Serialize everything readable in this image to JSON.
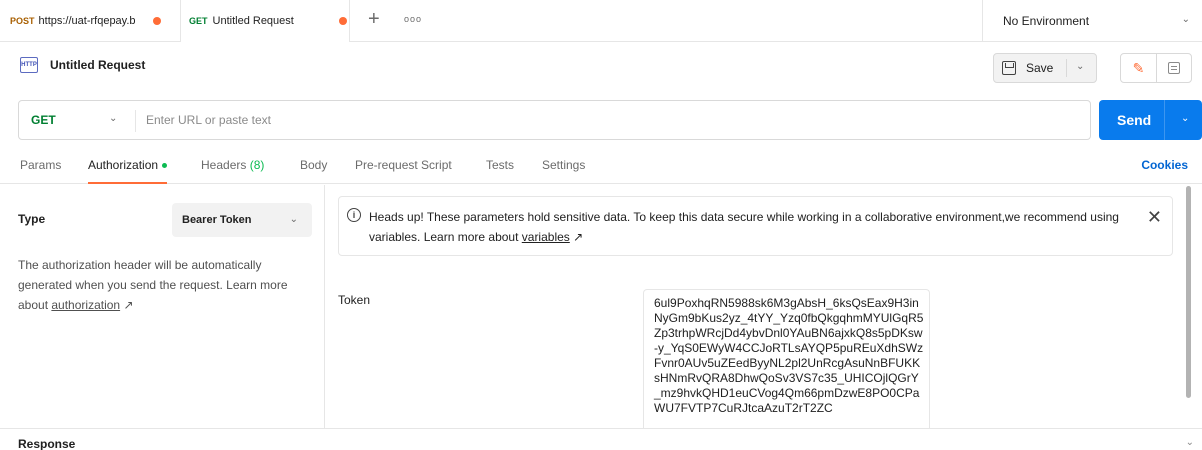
{
  "tabs": [
    {
      "method": "POST",
      "title": "https://uat-rfqepay.b"
    },
    {
      "method": "GET",
      "title": "Untitled Request"
    }
  ],
  "tabbar": {
    "new_tab_icon": "plus-icon",
    "more_icon": "more-horizontal-icon"
  },
  "environment": {
    "label": "No Environment"
  },
  "request": {
    "title": "Untitled Request",
    "icon_text": "HTTP",
    "save_label": "Save",
    "method": "GET",
    "url_placeholder": "Enter URL or paste text",
    "send_label": "Send"
  },
  "request_tabs": {
    "params": "Params",
    "authorization": "Authorization",
    "headers": "Headers",
    "headers_count": "(8)",
    "body": "Body",
    "prerequest": "Pre-request Script",
    "tests": "Tests",
    "settings": "Settings",
    "cookies": "Cookies"
  },
  "auth": {
    "type_label": "Type",
    "type_value": "Bearer Token",
    "desc_prefix": "The authorization header will be automatically generated when you send the request. Learn more about ",
    "desc_link": "authorization",
    "desc_arrow": "↗"
  },
  "notice": {
    "text_prefix": "Heads up! These parameters hold sensitive data. To keep this data secure while working in a collaborative environment,we recommend using variables. Learn more about ",
    "link": "variables",
    "arrow": "↗"
  },
  "token": {
    "label": "Token",
    "value": "6ul9PoxhqRN5988sk6M3gAbsH_6ksQsEax9H3inNyGm9bKus2yz_4tYY_Yzq0fbQkgqhmMYUlGqR5Zp3trhpWRcjDd4ybvDnl0YAuBN6ajxkQ8s5pDKsw-y_YqS0EWyW4CCJoRTLsAYQP5puREuXdhSWzFvnr0AUv5uZEedByyNL2pl2UnRcgAsuNnBFUKKsHNmRvQRA8DhwQoSv3VS7c35_UHICOjlQGrY_mz9hvkQHD1euCVog4Qm66pmDzwE8PO0CPaWU7FVTP7CuRJtcaAzuT2rT2ZC"
  },
  "response": {
    "label": "Response"
  },
  "colors": {
    "accent": "#ff6c37",
    "send": "#097bed",
    "get": "#007f31",
    "post": "#a85f00",
    "link": "#0265d2"
  }
}
